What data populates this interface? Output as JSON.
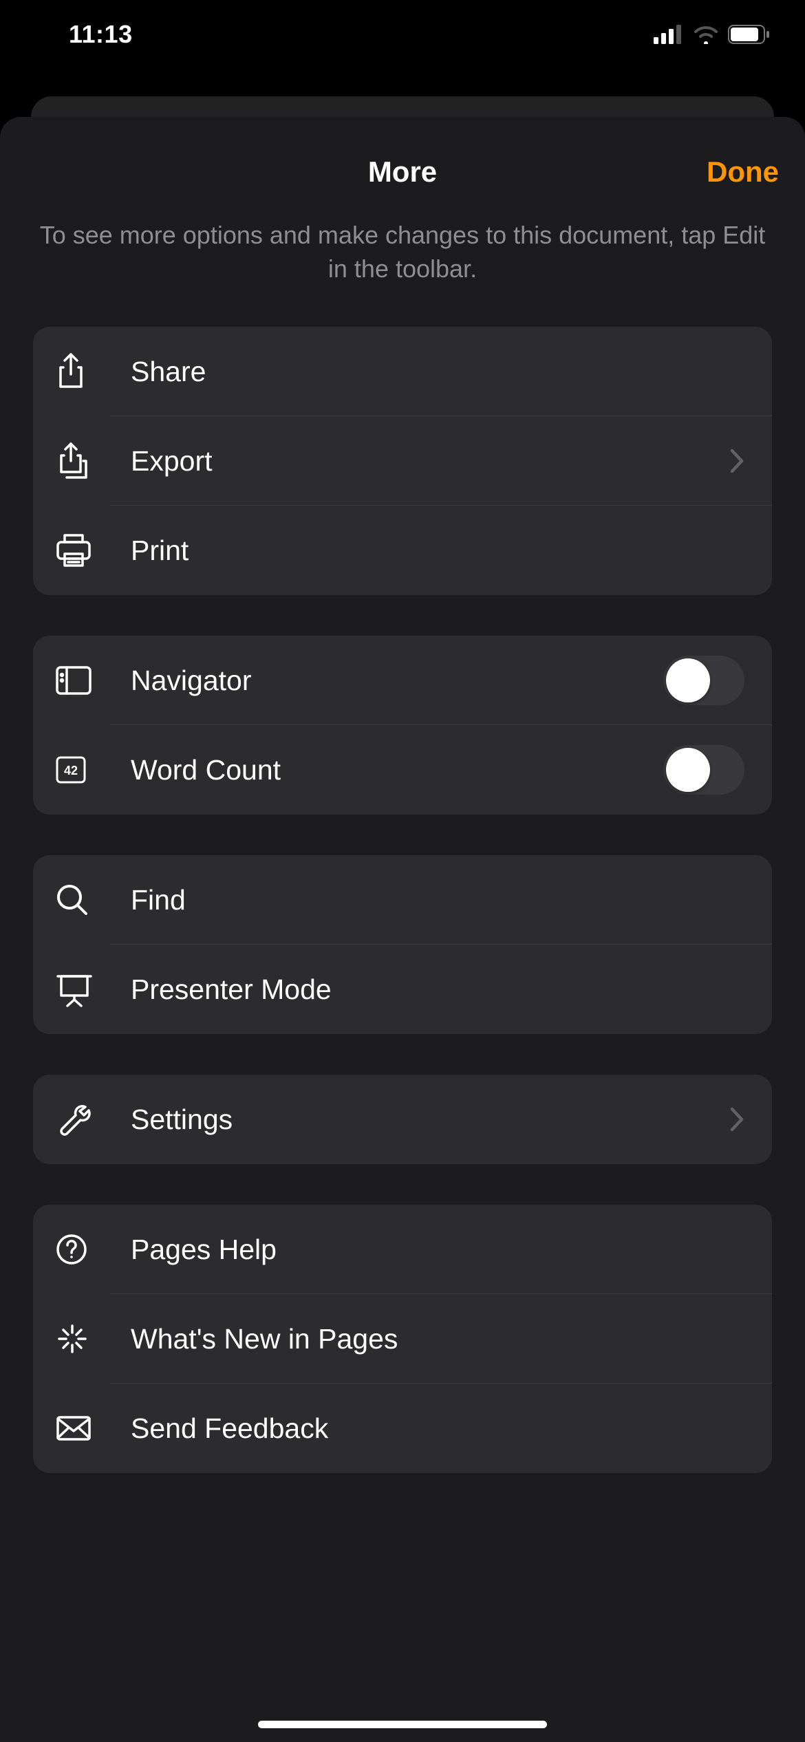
{
  "status": {
    "time": "11:13"
  },
  "sheet": {
    "title": "More",
    "done": "Done",
    "hint": "To see more options and make changes to this document, tap Edit in the toolbar."
  },
  "group1": {
    "share": "Share",
    "export": "Export",
    "print": "Print"
  },
  "group2": {
    "navigator": "Navigator",
    "wordcount": "Word Count"
  },
  "group3": {
    "find": "Find",
    "presenter": "Presenter Mode"
  },
  "group4": {
    "settings": "Settings"
  },
  "group5": {
    "help": "Pages Help",
    "whatsnew": "What's New in Pages",
    "feedback": "Send Feedback"
  }
}
